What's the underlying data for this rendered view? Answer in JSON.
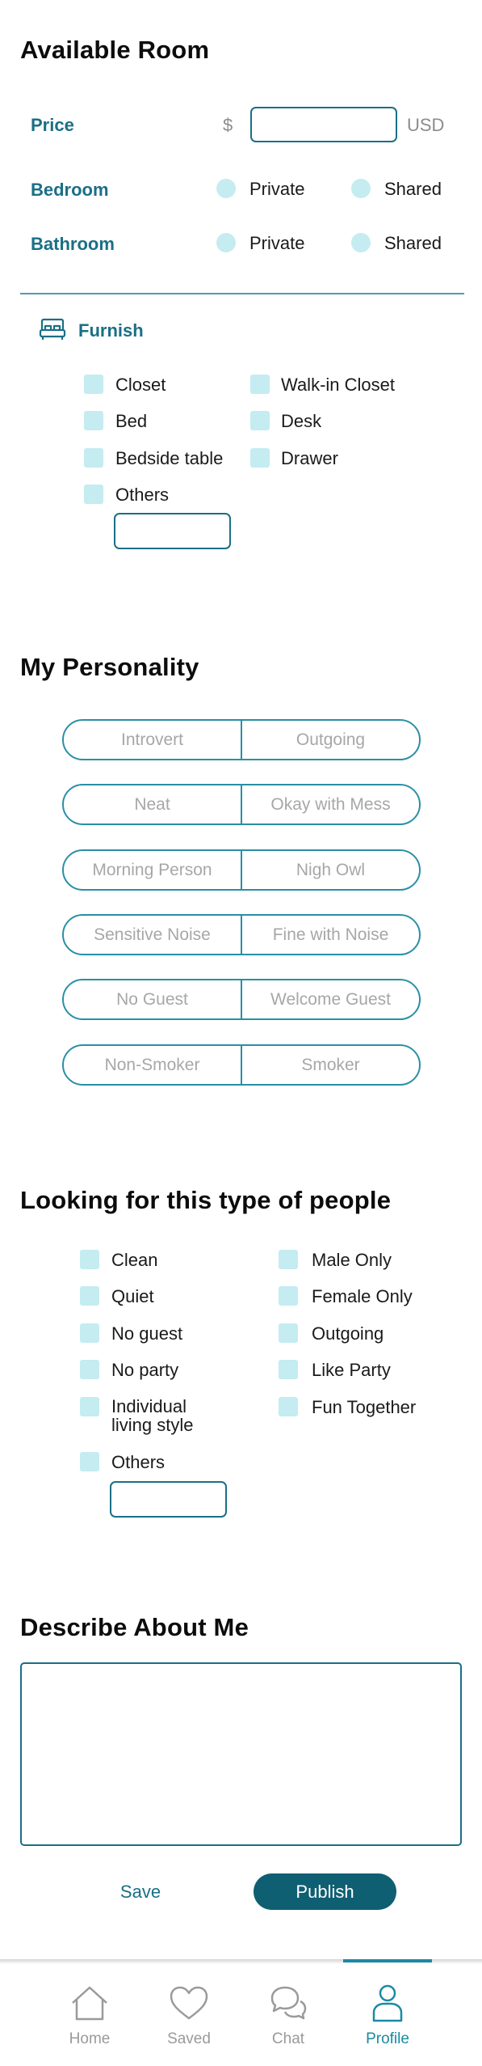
{
  "available_room": {
    "title": "Available Room",
    "price_label": "Price",
    "currency_symbol": "$",
    "price_value": "",
    "currency_code": "USD",
    "bedroom_label": "Bedroom",
    "bathroom_label": "Bathroom",
    "option_private": "Private",
    "option_shared": "Shared",
    "furnish_label": "Furnish",
    "furnish_items": [
      "Closet",
      "Walk-in Closet",
      "Bed",
      "Desk",
      "Bedside table",
      "Drawer",
      "Others"
    ],
    "furnish_other_value": ""
  },
  "personality": {
    "title": "My Personality",
    "pairs": [
      [
        "Introvert",
        "Outgoing"
      ],
      [
        "Neat",
        "Okay with Mess"
      ],
      [
        "Morning Person",
        "Nigh Owl"
      ],
      [
        "Sensitive Noise",
        "Fine with Noise"
      ],
      [
        "No Guest",
        "Welcome Guest"
      ],
      [
        "Non-Smoker",
        "Smoker"
      ]
    ]
  },
  "looking_for": {
    "title": "Looking for this type of people",
    "left": [
      "Clean",
      "Quiet",
      "No guest",
      "No party",
      "Individual living style",
      "Others"
    ],
    "right": [
      "Male Only",
      "Female Only",
      "Outgoing",
      "Like Party",
      "Fun Together"
    ],
    "other_value": ""
  },
  "describe": {
    "title": "Describe About Me",
    "value": ""
  },
  "actions": {
    "save_label": "Save",
    "publish_label": "Publish"
  },
  "nav": {
    "items": [
      {
        "label": "Home",
        "icon": "home-icon"
      },
      {
        "label": "Saved",
        "icon": "heart-icon"
      },
      {
        "label": "Chat",
        "icon": "chat-icon"
      },
      {
        "label": "Profile",
        "icon": "profile-icon"
      }
    ],
    "active": "Profile",
    "active_color": "#1a8aa4",
    "inactive_color": "#9a9a9a"
  },
  "colors": {
    "accent": "#1a6f86",
    "publish_bg": "#0f5f73",
    "control_fill": "#c4ecf1"
  }
}
